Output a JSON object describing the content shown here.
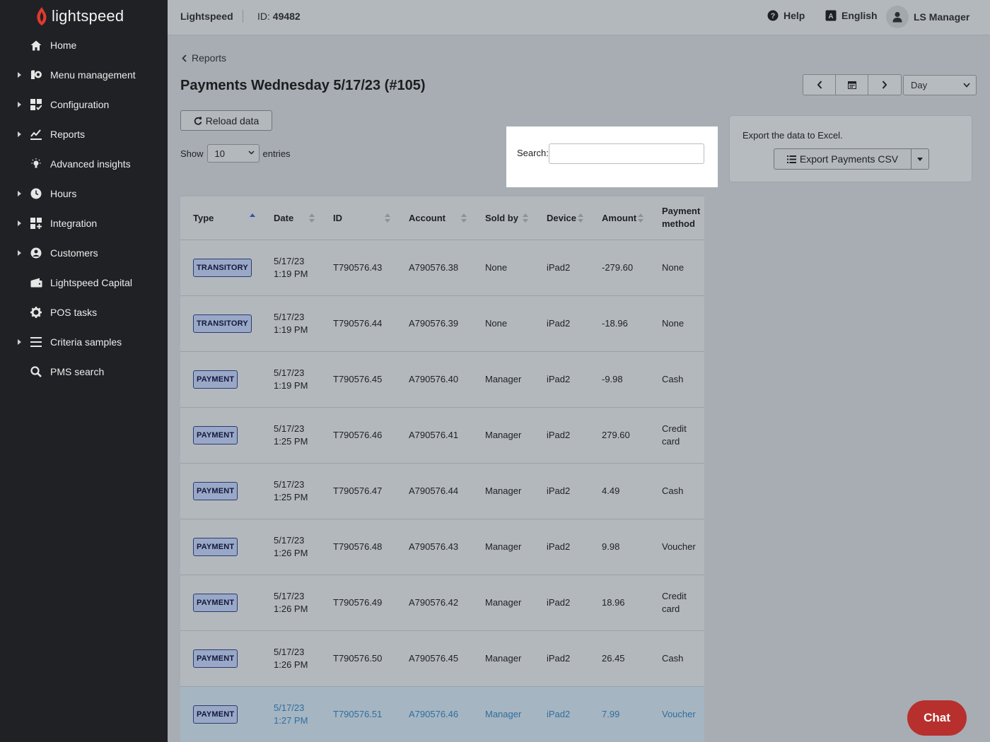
{
  "logo": {
    "text": "lightspeed",
    "color": "#e03a2e"
  },
  "sidebar": {
    "items": [
      {
        "label": "Home",
        "icon": "home-icon",
        "expandable": false
      },
      {
        "label": "Menu management",
        "icon": "menu-management-icon",
        "expandable": true
      },
      {
        "label": "Configuration",
        "icon": "configuration-icon",
        "expandable": true
      },
      {
        "label": "Reports",
        "icon": "reports-icon",
        "expandable": true
      },
      {
        "label": "Advanced insights",
        "icon": "lightbulb-icon",
        "expandable": false
      },
      {
        "label": "Hours",
        "icon": "clock-icon",
        "expandable": true
      },
      {
        "label": "Integration",
        "icon": "integration-icon",
        "expandable": true
      },
      {
        "label": "Customers",
        "icon": "customers-icon",
        "expandable": true
      },
      {
        "label": "Lightspeed Capital",
        "icon": "wallet-icon",
        "expandable": false
      },
      {
        "label": "POS tasks",
        "icon": "gear-icon",
        "expandable": false
      },
      {
        "label": "Criteria samples",
        "icon": "list-icon",
        "expandable": true
      },
      {
        "label": "PMS search",
        "icon": "search-icon",
        "expandable": false
      }
    ]
  },
  "topbar": {
    "brand": "Lightspeed",
    "id_prefix": "ID:",
    "id_value": "49482",
    "help": "Help",
    "language": "English",
    "user": "LS Manager"
  },
  "breadcrumb": "Reports",
  "page_title": "Payments Wednesday 5/17/23 (#105)",
  "period": "Day",
  "reload_label": "Reload data",
  "show_label": "Show",
  "entries_value": "10",
  "entries_label": "entries",
  "search": {
    "label": "Search:",
    "value": ""
  },
  "export": {
    "text": "Export the data to Excel.",
    "button": "Export Payments CSV"
  },
  "table": {
    "headers": [
      "Type",
      "Date",
      "ID",
      "Account",
      "Sold by",
      "Device",
      "Amount",
      "Payment method"
    ],
    "rows": [
      {
        "type": "TRANSITORY",
        "date": "5/17/23 1:19 PM",
        "id": "T790576.43",
        "account": "A790576.38",
        "sold_by": "None",
        "device": "iPad2",
        "amount": "-279.60",
        "method": "None"
      },
      {
        "type": "TRANSITORY",
        "date": "5/17/23 1:19 PM",
        "id": "T790576.44",
        "account": "A790576.39",
        "sold_by": "None",
        "device": "iPad2",
        "amount": "-18.96",
        "method": "None"
      },
      {
        "type": "PAYMENT",
        "date": "5/17/23 1:19 PM",
        "id": "T790576.45",
        "account": "A790576.40",
        "sold_by": "Manager",
        "device": "iPad2",
        "amount": "-9.98",
        "method": "Cash"
      },
      {
        "type": "PAYMENT",
        "date": "5/17/23 1:25 PM",
        "id": "T790576.46",
        "account": "A790576.41",
        "sold_by": "Manager",
        "device": "iPad2",
        "amount": "279.60",
        "method": "Credit card"
      },
      {
        "type": "PAYMENT",
        "date": "5/17/23 1:25 PM",
        "id": "T790576.47",
        "account": "A790576.44",
        "sold_by": "Manager",
        "device": "iPad2",
        "amount": "4.49",
        "method": "Cash"
      },
      {
        "type": "PAYMENT",
        "date": "5/17/23 1:26 PM",
        "id": "T790576.48",
        "account": "A790576.43",
        "sold_by": "Manager",
        "device": "iPad2",
        "amount": "9.98",
        "method": "Voucher"
      },
      {
        "type": "PAYMENT",
        "date": "5/17/23 1:26 PM",
        "id": "T790576.49",
        "account": "A790576.42",
        "sold_by": "Manager",
        "device": "iPad2",
        "amount": "18.96",
        "method": "Credit card"
      },
      {
        "type": "PAYMENT",
        "date": "5/17/23 1:26 PM",
        "id": "T790576.50",
        "account": "A790576.45",
        "sold_by": "Manager",
        "device": "iPad2",
        "amount": "26.45",
        "method": "Cash"
      },
      {
        "type": "PAYMENT",
        "date": "5/17/23 1:27 PM",
        "id": "T790576.51",
        "account": "A790576.46",
        "sold_by": "Manager",
        "device": "iPad2",
        "amount": "7.99",
        "method": "Voucher"
      }
    ]
  },
  "chat_label": "Chat",
  "colors": {
    "sidebar_bg": "#1f2124",
    "overlay": "#a7adb3",
    "chat": "#b8302d",
    "highlight_row": "#a6b5c2"
  }
}
